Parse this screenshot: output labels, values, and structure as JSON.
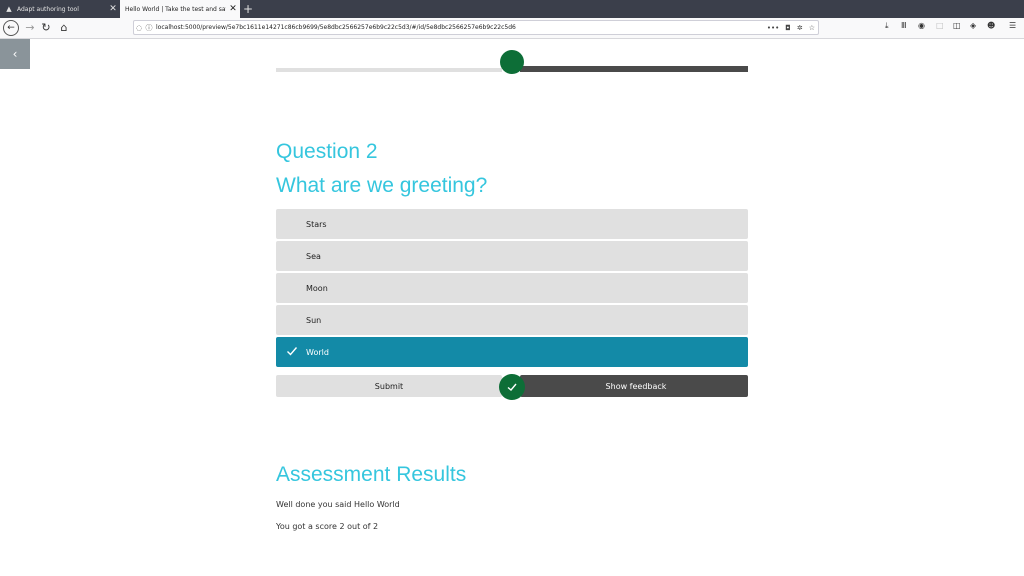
{
  "browser": {
    "tabs": [
      {
        "label": "Adapt authoring tool",
        "icon": "adapt-logo-icon",
        "active": false
      },
      {
        "label": "Hello World | Take the test and say",
        "icon": "page-icon",
        "active": true
      }
    ],
    "new_tab": "+",
    "url": "localhost:5000/preview/5e7bc1611e14271c86cb9699/5e8dbc2566257e6b9c22c5d3/#/id/5e8dbc2566257e6b9c22c5d6",
    "url_dots": "•••"
  },
  "page": {
    "sidebar_toggle": "‹",
    "question_title": "Question 2",
    "question_body": "What are we greeting?",
    "options": [
      {
        "label": "Stars",
        "selected": false
      },
      {
        "label": "Sea",
        "selected": false
      },
      {
        "label": "Moon",
        "selected": false
      },
      {
        "label": "Sun",
        "selected": false
      },
      {
        "label": "World",
        "selected": true
      }
    ],
    "submit_label": "Submit",
    "feedback_label": "Show feedback",
    "results_title": "Assessment Results",
    "results_line1": "Well done you said Hello World",
    "results_line2": "You got a score 2 out of 2"
  },
  "colors": {
    "accent": "#35c6de",
    "selected": "#138aa7",
    "correct": "#0d6e37",
    "dark_button": "#4a4a4a"
  }
}
